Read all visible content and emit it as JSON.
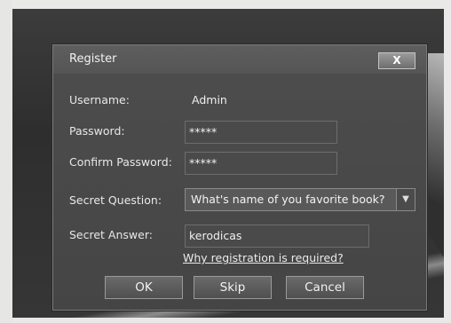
{
  "dialog": {
    "title": "Register",
    "close_label": "X"
  },
  "form": {
    "username_label": "Username:",
    "username_value": "Admin",
    "password_label": "Password:",
    "password_value": "*****",
    "confirm_label": "Confirm Password:",
    "confirm_value": "*****",
    "question_label": "Secret Question:",
    "question_value": "What's name of you favorite book?",
    "answer_label": "Secret Answer:",
    "answer_value": "kerodicas",
    "help_link": "Why registration is required?"
  },
  "buttons": {
    "ok": "OK",
    "skip": "Skip",
    "cancel": "Cancel"
  },
  "icons": {
    "dropdown": "chevron-down-icon",
    "close": "close-icon"
  }
}
